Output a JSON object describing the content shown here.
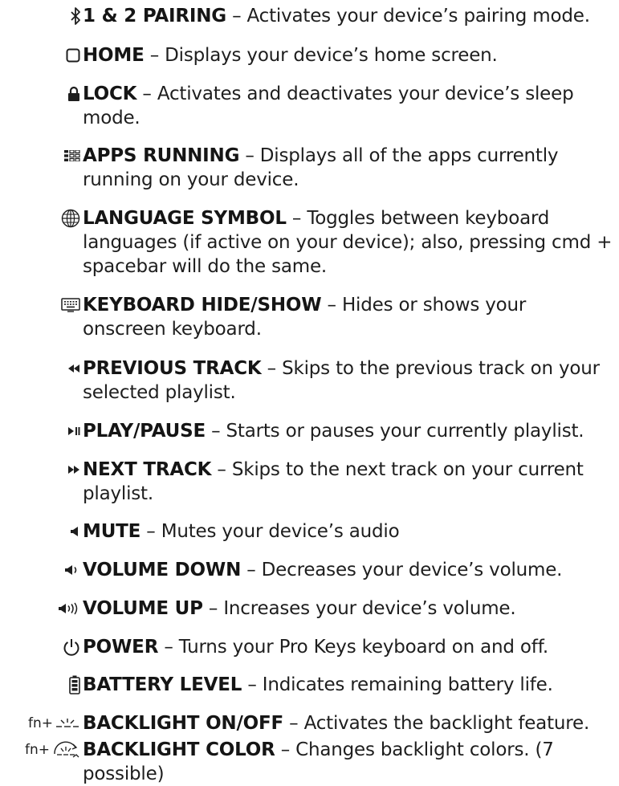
{
  "items": [
    {
      "icon": "bluetooth-icon",
      "term": "1 & 2 PAIRING",
      "desc": " – Activates your device’s pairing mode."
    },
    {
      "icon": "home-square-icon",
      "term": "HOME",
      "desc": " – Displays your device’s home screen."
    },
    {
      "icon": "lock-icon",
      "term": "LOCK",
      "desc": " – Activates and deactivates your device’s sleep mode."
    },
    {
      "icon": "apps-grid-icon",
      "term": "APPS RUNNING",
      "desc": " – Displays all of the apps currently running on your device."
    },
    {
      "icon": "globe-icon",
      "term": "LANGUAGE SYMBOL",
      "desc": " – Toggles between keyboard languages (if active on your device); also, pressing cmd + spacebar will do the same."
    },
    {
      "icon": "keyboard-icon",
      "term": "KEYBOARD HIDE/SHOW",
      "desc": " – Hides or shows your onscreen keyboard."
    },
    {
      "icon": "previous-track-icon",
      "term": "PREVIOUS TRACK",
      "desc": " – Skips to the previous track on your selected playlist."
    },
    {
      "icon": "play-pause-icon",
      "term": "PLAY/PAUSE",
      "desc": " – Starts or pauses your currently playlist."
    },
    {
      "icon": "next-track-icon",
      "term": "NEXT TRACK",
      "desc": " – Skips to the next track on your current playlist."
    },
    {
      "icon": "mute-icon",
      "term": "MUTE",
      "desc": " – Mutes your device’s audio"
    },
    {
      "icon": "volume-down-icon",
      "term": "VOLUME DOWN",
      "desc": " – Decreases your device’s volume."
    },
    {
      "icon": "volume-up-icon",
      "term": "VOLUME UP",
      "desc": " – Increases your device’s volume."
    },
    {
      "icon": "power-icon",
      "term": "POWER",
      "desc": " – Turns your Pro Keys keyboard on and off."
    },
    {
      "icon": "battery-icon",
      "term": "BATTERY LEVEL",
      "desc": " – Indicates remaining battery life."
    },
    {
      "icon": "backlight-on-off-icon",
      "fn": "fn+",
      "term": "BACKLIGHT ON/OFF",
      "desc": " – Activates the backlight feature."
    },
    {
      "icon": "backlight-color-icon",
      "fn": "fn+",
      "term": "BACKLIGHT COLOR",
      "desc": " – Changes backlight colors. (7 possible)"
    }
  ],
  "colors": {
    "text": "#1e1e1e",
    "icon": "#1e1e1e"
  }
}
